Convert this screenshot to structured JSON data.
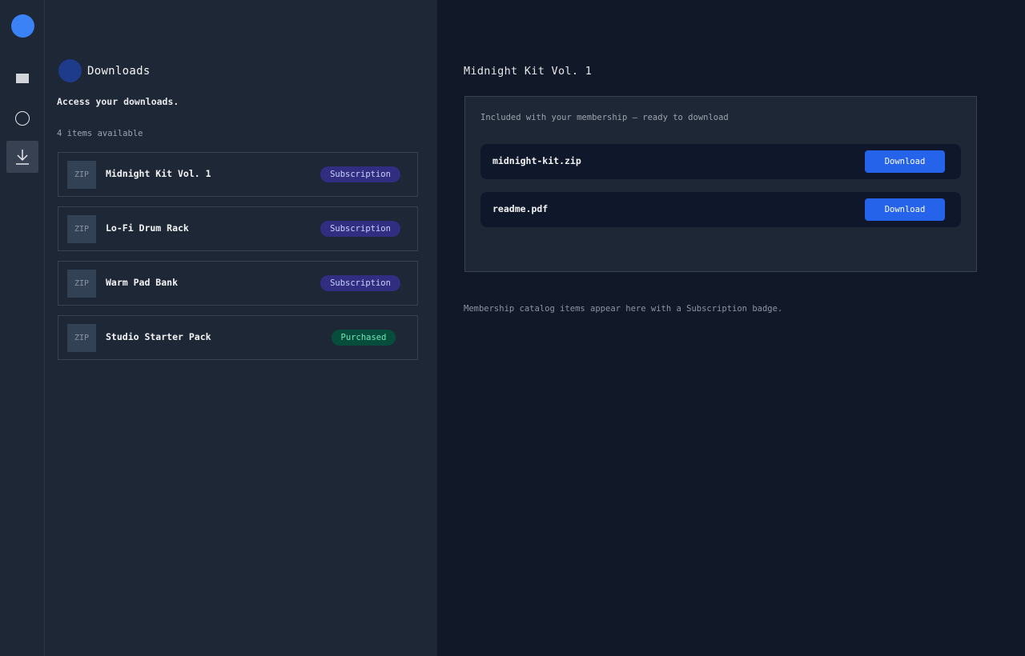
{
  "rail": {
    "items": [
      {
        "name": "library-icon"
      },
      {
        "name": "account-icon"
      },
      {
        "name": "download-icon",
        "active": true
      }
    ]
  },
  "list": {
    "title": "Downloads",
    "subtitle": "Access your downloads.",
    "count": "4 items available",
    "items": [
      {
        "thumb": "ZIP",
        "name": "Midnight Kit Vol. 1",
        "badge": "Subscription"
      },
      {
        "thumb": "ZIP",
        "name": "Lo-Fi Drum Rack",
        "badge": "Subscription"
      },
      {
        "thumb": "ZIP",
        "name": "Warm Pad Bank",
        "badge": "Subscription"
      },
      {
        "thumb": "ZIP",
        "name": "Studio Starter Pack",
        "badge": "Purchased"
      }
    ]
  },
  "detail": {
    "title": "Midnight Kit Vol. 1",
    "note": "Included with your membership — ready to download",
    "files": [
      {
        "name": "midnight-kit.zip",
        "button": "Download"
      },
      {
        "name": "readme.pdf",
        "button": "Download"
      }
    ],
    "footnote": "Membership catalog items appear here with a Subscription badge."
  },
  "colors": {
    "accent": "#2563eb",
    "subscription_badge": "#312e81",
    "purchased_badge": "#064e3b"
  }
}
